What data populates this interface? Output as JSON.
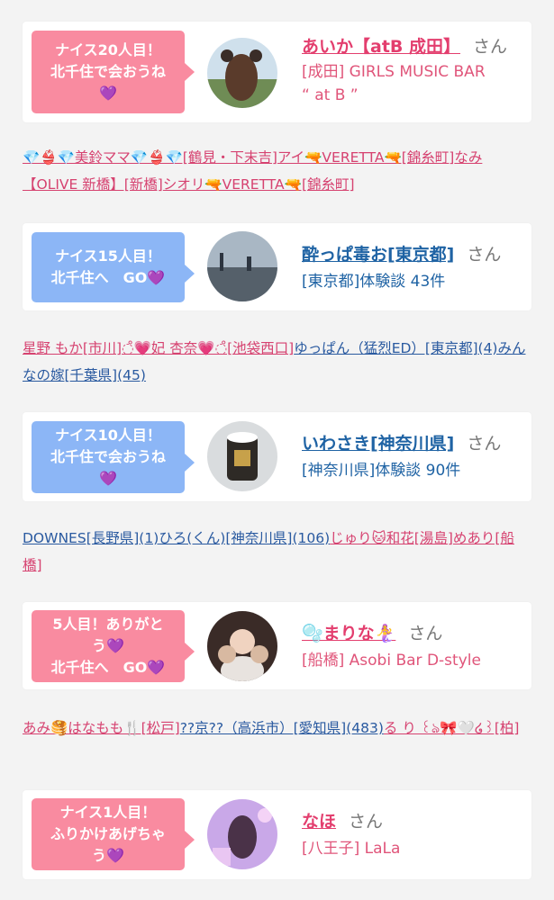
{
  "cards": [
    {
      "bubble_lines": [
        "ナイス20人目！",
        "北千住で会おうね",
        "💜"
      ],
      "name": "あいか【atB 成田】",
      "san": "さん",
      "sub_lines": [
        "[成田] GIRLS MUSIC BAR",
        "“ at B ”"
      ]
    },
    {
      "bubble_lines": [
        "ナイス15人目！",
        "北千住へ　GO💜"
      ],
      "name": "酔っぱ毒お[東京都]",
      "san": "さん",
      "sub_lines": [
        "[東京都]体験談 43件"
      ]
    },
    {
      "bubble_lines": [
        "ナイス10人目！",
        "北千住で会おうね",
        "💜"
      ],
      "name": "いわさき[神奈川県]",
      "san": "さん",
      "sub_lines": [
        "[神奈川県]体験談 90件"
      ]
    },
    {
      "bubble_lines": [
        "5人目！ありがと",
        "う💜",
        "北千住へ　GO💜"
      ],
      "name": "🫧まりな🧜‍♀️",
      "san": "さん",
      "sub_lines": [
        "[船橋] Asobi Bar D-style"
      ]
    },
    {
      "bubble_lines": [
        "ナイス1人目！",
        "ふりかけあげちゃ",
        "う💜"
      ],
      "name": "なほ",
      "san": "さん",
      "sub_lines": [
        "[八王子] LaLa"
      ]
    }
  ],
  "link_rows": [
    [
      "💎👙💎美鈴ママ💎👙💎[鶴見・下末吉]",
      "アイ🔫VERETTA🔫[錦糸町]",
      "なみ【OLIVE 新橋】[新橋]",
      "シオリ🔫VERETTA🔫[錦糸町]"
    ],
    [
      "星野 もか[市川]",
      "◌̊💗妃 杏奈💗◌̊[池袋西口]",
      "ゆっぱん（猛烈ED）[東京都](4)",
      "みんなの嫁[千葉県](45)"
    ],
    [
      "DOWNES[長野県](1)",
      "ひろ(くん)[神奈川県](106)",
      "じゅり🐱和花[湯島]",
      "めあり[船橋]"
    ],
    [
      "あみ🥞はなもも🍴[松戸]",
      "??京??（高浜市）[愛知県](483)",
      "る り ꒰ঌ🎀🤍໒꒱[柏]"
    ]
  ],
  "colors": {
    "pink": "#f98ba0",
    "blue": "#8cb6f6",
    "name_pink": "#e33e6e",
    "name_blue": "#1f63a4",
    "bg": "#f3f3f3"
  },
  "icons": [
    "avatar-photo-icon"
  ]
}
